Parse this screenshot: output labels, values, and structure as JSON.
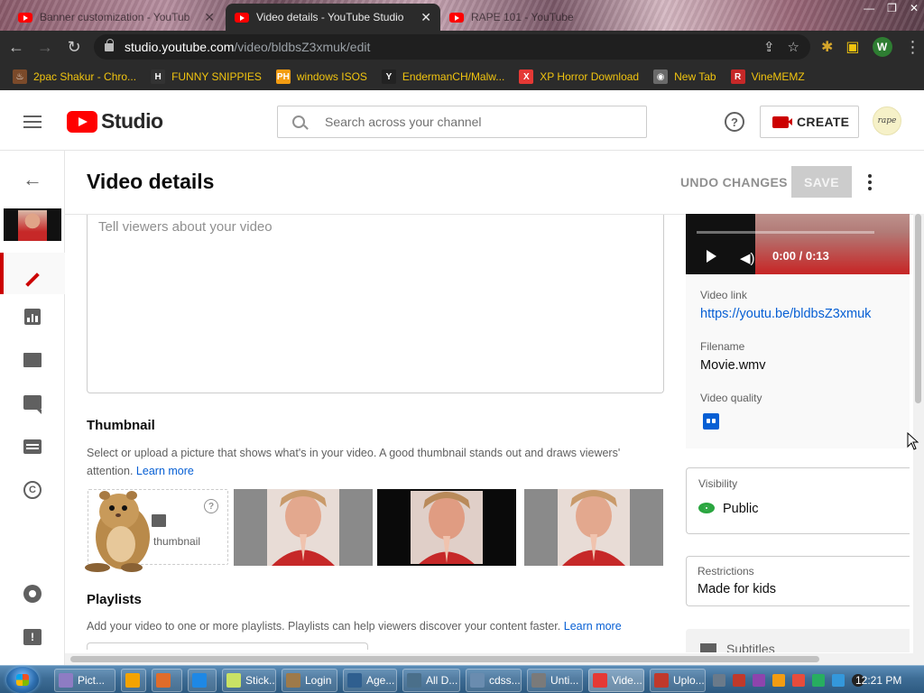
{
  "browser": {
    "tabs": [
      {
        "title": "Banner customization - YouTub",
        "active": false
      },
      {
        "title": "Video details - YouTube Studio",
        "active": true
      },
      {
        "title": "RAPE 101 - YouTube",
        "active": false
      }
    ],
    "url_host": "studio.youtube.com",
    "url_path": "/video/bldbsZ3xmuk/edit",
    "profile_initial": "W",
    "bookmarks": [
      {
        "label": "2pac Shakur - Chro...",
        "icon": "fire-icon",
        "color": "#7b4a2a",
        "glyph": "♨"
      },
      {
        "label": "FUNNY SNIPPIES",
        "icon": "h-logo-icon",
        "color": "#333333",
        "glyph": "H"
      },
      {
        "label": "windows ISOS",
        "icon": "ph-logo-icon",
        "color": "#f39c12",
        "glyph": "PH"
      },
      {
        "label": "EndermanCH/Malw...",
        "icon": "yp-logo-icon",
        "color": "#222222",
        "glyph": "Y"
      },
      {
        "label": "XP Horror Download",
        "icon": "x-logo-icon",
        "color": "#e53935",
        "glyph": "X"
      },
      {
        "label": "New Tab",
        "icon": "globe-icon",
        "color": "#6a6a6a",
        "glyph": "◉"
      },
      {
        "label": "VineMEMZ",
        "icon": "r-logo-icon",
        "color": "#c62828",
        "glyph": "R"
      }
    ]
  },
  "header": {
    "logo_text": "Studio",
    "search_placeholder": "Search across your channel",
    "help_glyph": "?",
    "create_label": "CREATE",
    "avatar_text": "rape"
  },
  "page": {
    "title": "Video details",
    "undo_label": "UNDO CHANGES",
    "save_label": "SAVE",
    "description_placeholder": "Tell viewers about your video",
    "thumbnail": {
      "title": "Thumbnail",
      "desc": "Select or upload a picture that shows what's in your video. A good thumbnail stands out and draws viewers' attention.",
      "learn_more": "Learn more",
      "upload_label": "thumbnail",
      "help_glyph": "?"
    },
    "playlists": {
      "title": "Playlists",
      "desc": "Add your video to one or more playlists. Playlists can help viewers discover your content faster.",
      "learn_more": "Learn more"
    }
  },
  "right_panel": {
    "time": "0:00 / 0:13",
    "video_link_label": "Video link",
    "video_link": "https://youtu.be/bldbsZ3xmuk",
    "filename_label": "Filename",
    "filename": "Movie.wmv",
    "quality_label": "Video quality",
    "visibility_label": "Visibility",
    "visibility_value": "Public",
    "restrictions_label": "Restrictions",
    "restrictions_value": "Made for kids",
    "subtitles_label": "Subtitles"
  },
  "taskbar": {
    "items": [
      {
        "label": "Pict...",
        "color": "#8e7cc3"
      },
      {
        "label": "",
        "color": "#f4a300"
      },
      {
        "label": "",
        "color": "#e06c2a"
      },
      {
        "label": "",
        "color": "#1e88e5"
      },
      {
        "label": "Stick...",
        "color": "#c9e265"
      },
      {
        "label": "Login",
        "color": "#9e7a4a"
      },
      {
        "label": "Age...",
        "color": "#2f5f8f"
      },
      {
        "label": "All D...",
        "color": "#4a6f8a"
      },
      {
        "label": "cdss...",
        "color": "#6a8caf"
      },
      {
        "label": "Unti...",
        "color": "#7a7a7a"
      },
      {
        "label": "Vide...",
        "color": "#e53935"
      },
      {
        "label": "Uplo...",
        "color": "#c0392b"
      }
    ],
    "clock": "12:21 PM"
  },
  "colors": {
    "accent_red": "#cc0000",
    "link_blue": "#065fd4",
    "public_green": "#2ba640"
  }
}
